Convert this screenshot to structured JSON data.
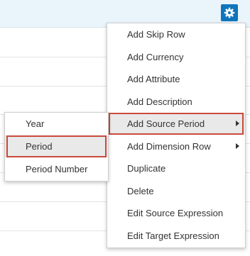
{
  "toolbar": {
    "settings_icon": "gear-icon"
  },
  "context_menu": {
    "items": [
      {
        "label": "Add Skip Row"
      },
      {
        "label": "Add Currency"
      },
      {
        "label": "Add Attribute"
      },
      {
        "label": "Add Description"
      },
      {
        "label": "Add Source Period",
        "submenu": true,
        "highlighted": true
      },
      {
        "label": "Add Dimension Row",
        "submenu": true
      },
      {
        "label": "Duplicate"
      },
      {
        "label": "Delete"
      },
      {
        "label": "Edit Source Expression"
      },
      {
        "label": "Edit Target Expression"
      }
    ]
  },
  "submenu": {
    "items": [
      {
        "label": "Year"
      },
      {
        "label": "Period",
        "highlighted": true
      },
      {
        "label": "Period Number"
      }
    ]
  },
  "colors": {
    "header_bg": "#e9f4fb",
    "gear_button_bg": "#0f75bc",
    "highlight_border": "#c94a3b",
    "highlight_bg": "#e9e9e9"
  }
}
